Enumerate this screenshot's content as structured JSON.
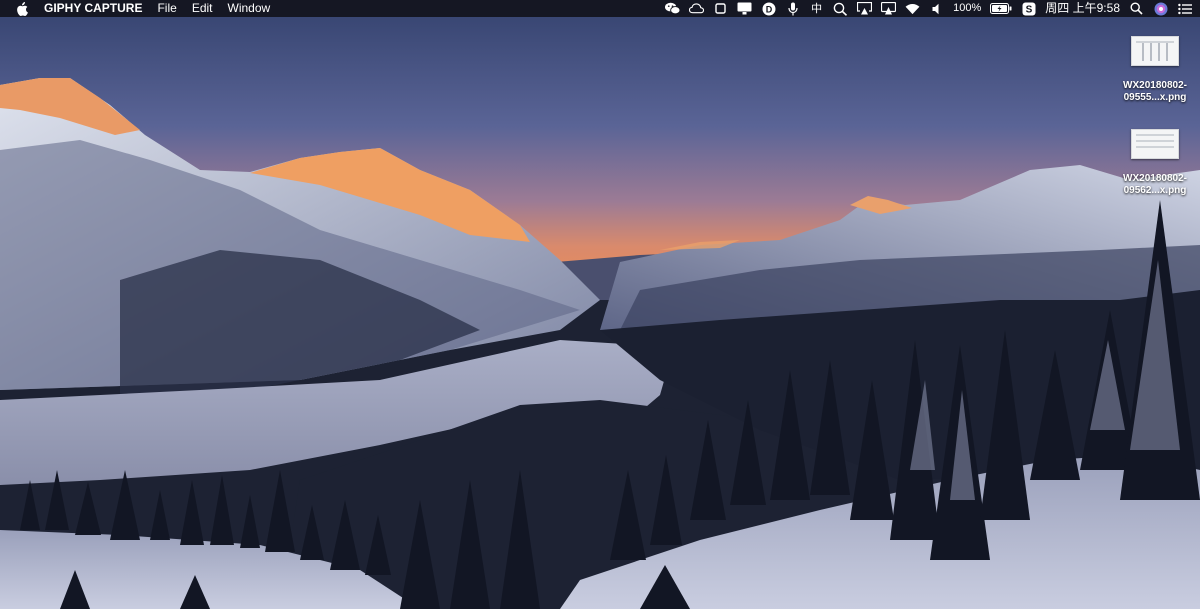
{
  "menubar": {
    "app_name": "GIPHY CAPTURE",
    "menus": [
      "File",
      "Edit",
      "Window"
    ],
    "input_method": "中",
    "battery_percent": "100%",
    "clock": "周四 上午9:58"
  },
  "status_icons": [
    "wechat-icon",
    "creative-cloud-icon",
    "square-icon",
    "monitor-icon",
    "dictionary-icon",
    "microphone-icon",
    "input-method-icon",
    "search-refresh-icon",
    "airplay-display-icon",
    "airplay-icon",
    "wifi-icon",
    "volume-icon",
    "battery-icon",
    "sogou-icon",
    "spotlight-icon",
    "siri-icon",
    "notification-center-icon"
  ],
  "desktop": {
    "files": [
      {
        "name": "WX20180802-\n09555...x.png"
      },
      {
        "name": "WX20180802-\n09562...x.png"
      }
    ]
  },
  "colors": {
    "menubar_bg": "#12141c",
    "sky_top": "#3b4a78",
    "sunset_glow": "#e08a5e",
    "alpenglow": "#f2a46a"
  }
}
